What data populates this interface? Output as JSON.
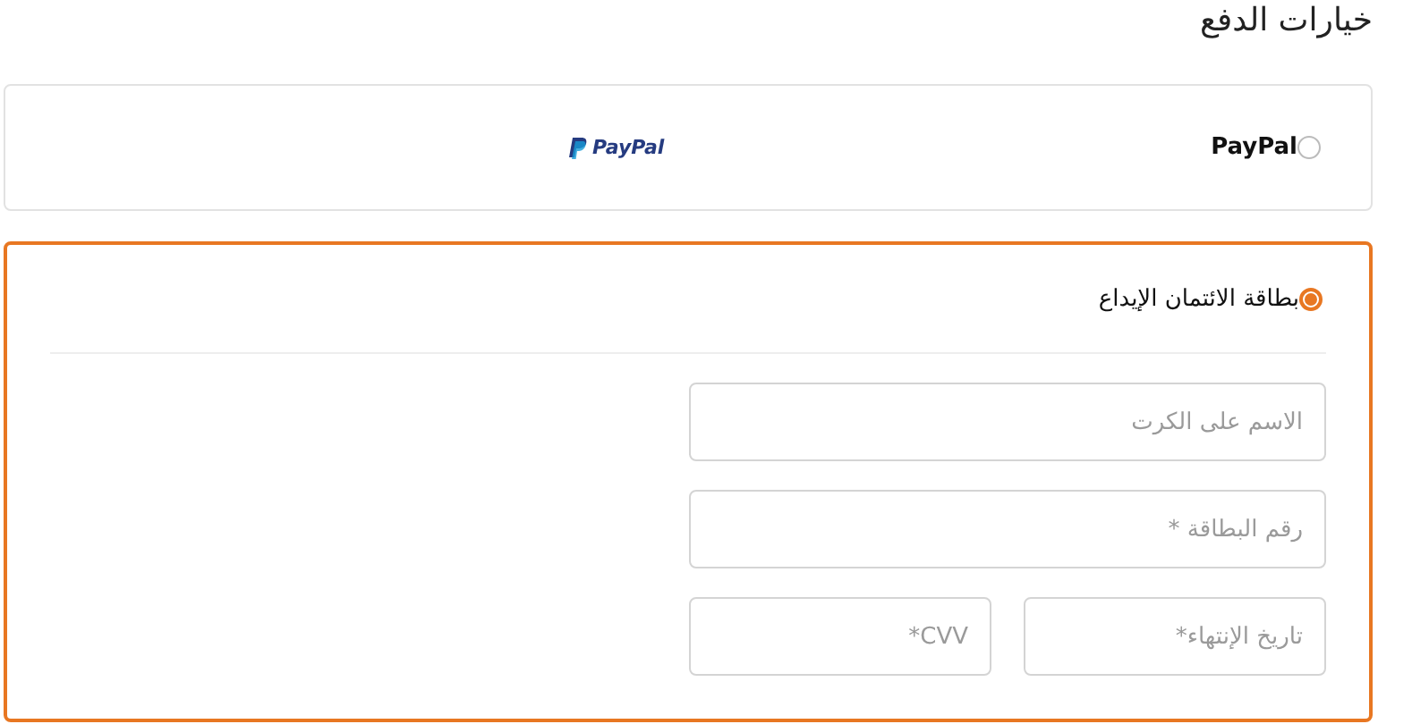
{
  "title": "خيارات الدفع",
  "options": [
    {
      "kind": "paypal",
      "label": "PayPal",
      "logo_text": "PayPal",
      "selected": false
    },
    {
      "kind": "card",
      "label": "بطاقة الائتمان الإيداع",
      "selected": true,
      "fields": [
        {
          "kind": "wide",
          "placeholder": "الاسم على الكرت"
        },
        {
          "kind": "wide",
          "placeholder": "رقم البطاقة *"
        },
        {
          "kind": "narrow",
          "placeholder": "تاريخ الإنتهاء*"
        },
        {
          "kind": "narrow",
          "placeholder": "CVV*"
        }
      ]
    }
  ]
}
